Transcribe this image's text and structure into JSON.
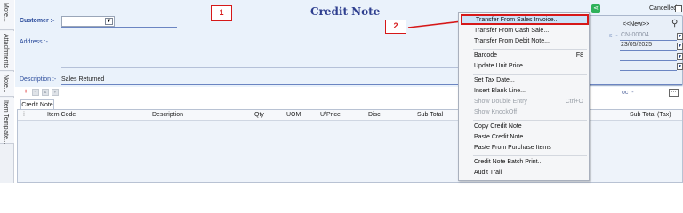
{
  "sidebar": {
    "tabs": [
      {
        "label": "More..."
      },
      {
        "label": "Attachments"
      },
      {
        "label": "Note..."
      },
      {
        "label": "Item Template..."
      }
    ]
  },
  "header": {
    "title": "Credit Note",
    "customer_label": "Customer :-",
    "address_label": "Address :-",
    "description_label": "Description :-",
    "description_value": "Sales Returned",
    "cancelled_label": "Cancelled"
  },
  "callouts": {
    "one": "1",
    "two": "2"
  },
  "right_panel": {
    "new_label": "<<New>>",
    "doc_no": "CN-00004",
    "date": "23/05/2025",
    "doc_label_partial": "oc :-",
    "label_fragment": "s :-"
  },
  "toolbar": {
    "add_icon": "+",
    "remove_icon": "−",
    "up_icon": "▲",
    "down_icon": "▼"
  },
  "tabs": {
    "active": "Credit Note"
  },
  "grid": {
    "columns": [
      "Item Code",
      "Description",
      "Qty",
      "UOM",
      "U/Price",
      "Disc",
      "Sub Total",
      "Sub Total (Tax)"
    ]
  },
  "context_menu": {
    "items": [
      {
        "label": "Transfer From Sales Invoice...",
        "highlighted": true
      },
      {
        "label": "Transfer From Cash Sale..."
      },
      {
        "label": "Transfer From Debit Note..."
      },
      {
        "label": "Barcode",
        "shortcut": "F8"
      },
      {
        "label": "Update Unit Price"
      },
      {
        "label": "Set Tax Date..."
      },
      {
        "label": "Insert Blank Line..."
      },
      {
        "label": "Show Double Entry",
        "shortcut": "Ctrl+O",
        "disabled": true
      },
      {
        "label": "Show KnockOff",
        "disabled": true
      },
      {
        "label": "Copy Credit Note"
      },
      {
        "label": "Paste Credit Note"
      },
      {
        "label": "Paste From Purchase Items"
      },
      {
        "label": "Credit Note Batch Print..."
      },
      {
        "label": "Audit Trail"
      }
    ]
  },
  "colors": {
    "accent_red": "#d61818",
    "header_blue": "#2f3f8f",
    "menu_highlight": "#cce3f8"
  }
}
